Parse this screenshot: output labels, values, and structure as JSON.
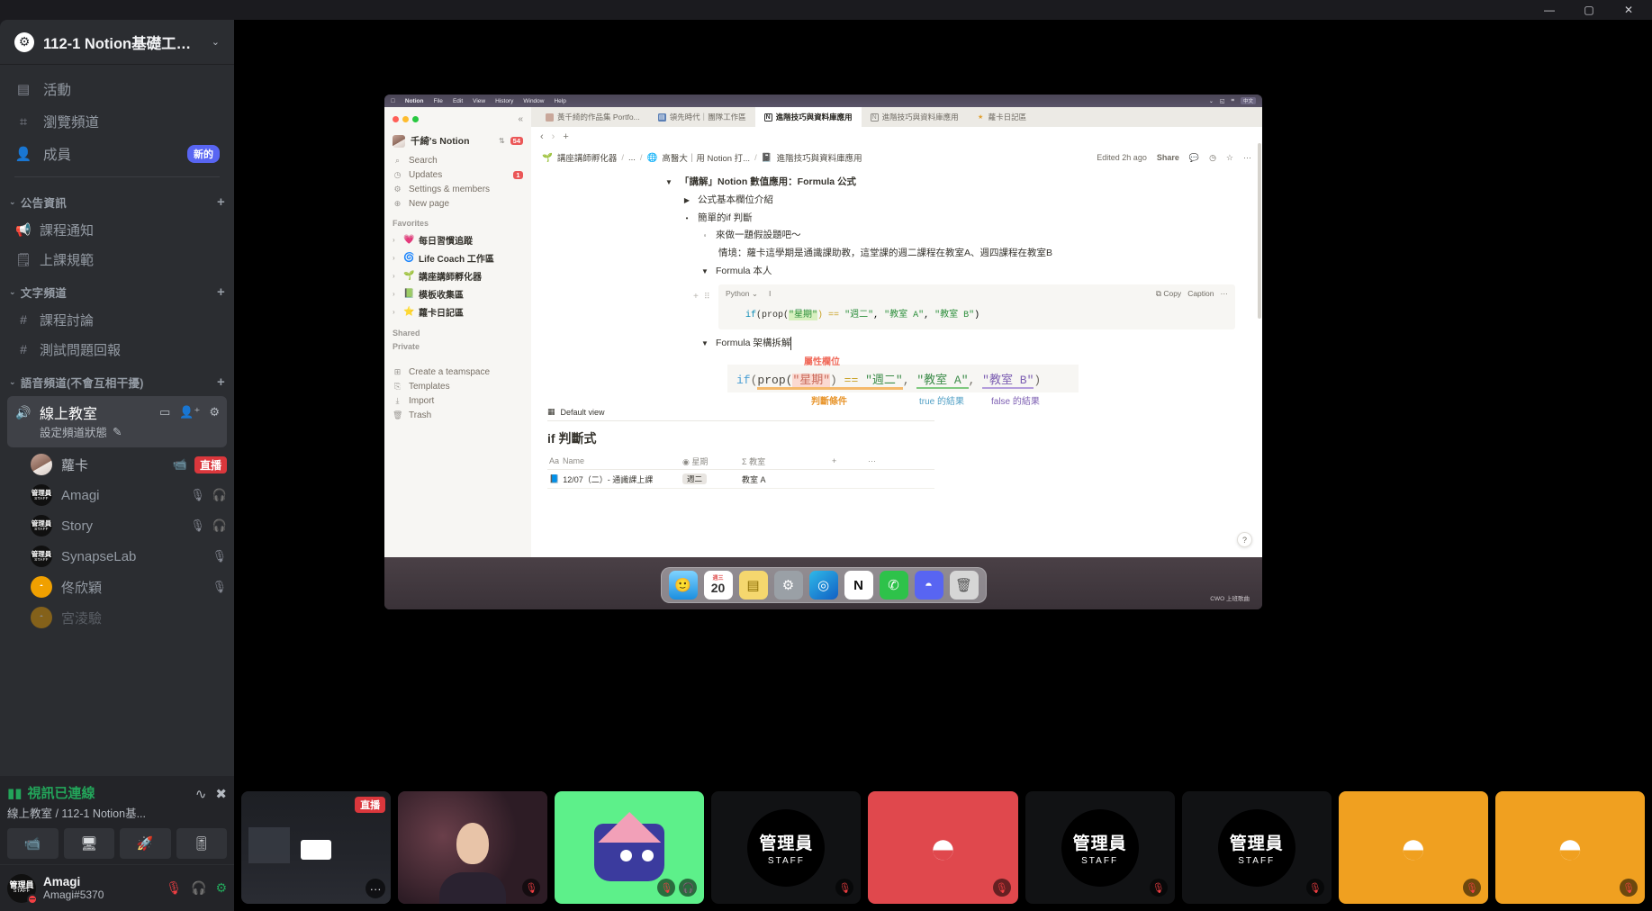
{
  "window": {
    "minimize": "—",
    "maximize": "▢",
    "close": "✕"
  },
  "sidebar": {
    "guild": {
      "name": "112-1 Notion基礎工作...",
      "icon": "gear-icon",
      "caret": "⌄"
    },
    "nav": [
      {
        "icon": "calendar-icon",
        "glyph": "▤",
        "label": "活動",
        "badge": ""
      },
      {
        "icon": "compass-icon",
        "glyph": "⌗",
        "label": "瀏覽頻道",
        "badge": ""
      },
      {
        "icon": "members-icon",
        "glyph": "👤",
        "label": "成員",
        "badge": "新的"
      }
    ],
    "categories": [
      {
        "name": "公告資訊",
        "caret": "⌄",
        "plus": "+",
        "channels": [
          {
            "icon": "megaphone-icon",
            "glyph": "📢",
            "label": "課程通知"
          },
          {
            "icon": "rules-icon",
            "glyph": "🗒",
            "label": "上課規範"
          }
        ]
      },
      {
        "name": "文字頻道",
        "caret": "⌄",
        "plus": "+",
        "channels": [
          {
            "icon": "hash-lock-icon",
            "glyph": "#",
            "label": "課程討論"
          },
          {
            "icon": "hash-lock-icon",
            "glyph": "#",
            "label": "測試問題回報"
          }
        ]
      },
      {
        "name": "語音頻道(不會互相干擾)",
        "caret": "⌄",
        "plus": "+",
        "channels": []
      }
    ],
    "voice_channel": {
      "name": "線上教室",
      "icon": "speaker-lock-icon",
      "status_text": "設定頻道狀態",
      "status_icon": "pencil-icon",
      "actions": [
        "chat-icon",
        "invite-icon",
        "settings-icon"
      ]
    },
    "members": [
      {
        "name": "蘿卡",
        "avatar": "photo",
        "live": true,
        "live_label": "直播",
        "icons": [
          "camera-icon"
        ]
      },
      {
        "name": "Amagi",
        "avatar": "staff",
        "icons": [
          "mic-muted-icon",
          "deafen-icon"
        ]
      },
      {
        "name": "Story",
        "avatar": "staff",
        "icons": [
          "mic-muted-icon",
          "deafen-icon"
        ]
      },
      {
        "name": "SynapseLab",
        "avatar": "staff",
        "icons": [
          "mic-muted-icon"
        ]
      },
      {
        "name": "佟欣穎",
        "avatar": "discord",
        "icons": [
          "mic-muted-icon"
        ]
      },
      {
        "name": "宮淩驗",
        "avatar": "discord",
        "icons": []
      }
    ],
    "voice_panel": {
      "title": "視訊已連線",
      "signal_icon": "signal-icon",
      "subtitle": "線上教室 / 112-1 Notion基...",
      "ping_icon": "ping-icon",
      "disconnect_icon": "disconnect-icon",
      "buttons": [
        "camera-icon",
        "screenshare-icon",
        "activity-rocket-icon",
        "soundboard-icon"
      ]
    },
    "user_panel": {
      "name": "Amagi",
      "tag": "Amagi#5370",
      "avatar_label": "管理員",
      "avatar_sub": "STAFF",
      "icons": [
        "mic-muted-icon",
        "deafen-muted-icon",
        "settings-icon"
      ]
    }
  },
  "screenshare": {
    "macos_menu": [
      "",
      "Notion",
      "File",
      "Edit",
      "View",
      "History",
      "Window",
      "Help"
    ],
    "macos_menu_right": [
      "⌄",
      "◱",
      "⌗",
      "中文"
    ],
    "notion": {
      "workspace": {
        "name": "千綺's Notion",
        "switch_icon": "chevron-updown-icon",
        "badge": "54"
      },
      "sidebar_items": [
        {
          "icon": "search-icon",
          "glyph": "⌕",
          "label": "Search",
          "badge": ""
        },
        {
          "icon": "clock-icon",
          "glyph": "◷",
          "label": "Updates",
          "badge": "1"
        },
        {
          "icon": "gear-icon",
          "glyph": "⚙",
          "label": "Settings & members",
          "badge": ""
        },
        {
          "icon": "plus-circle-icon",
          "glyph": "⊕",
          "label": "New page",
          "badge": ""
        }
      ],
      "sections": [
        {
          "title": "Favorites",
          "items": [
            {
              "emoji": "💗",
              "label": "每日習慣追蹤"
            },
            {
              "emoji": "🌀",
              "label": "Life Coach 工作區"
            },
            {
              "emoji": "🌱",
              "label": "講座講師孵化器"
            },
            {
              "emoji": "📗",
              "label": "模板收集區"
            },
            {
              "emoji": "⭐",
              "label": "蘿卡日記區"
            }
          ]
        },
        {
          "title": "Shared",
          "items": []
        },
        {
          "title": "Private",
          "items": []
        }
      ],
      "footer_items": [
        {
          "icon": "teamspace-icon",
          "glyph": "⊞",
          "label": "Create a teamspace"
        },
        {
          "icon": "templates-icon",
          "glyph": "⎘",
          "label": "Templates"
        },
        {
          "icon": "import-icon",
          "glyph": "⤓",
          "label": "Import"
        },
        {
          "icon": "trash-icon",
          "glyph": "🗑",
          "label": "Trash"
        }
      ],
      "tabs": [
        {
          "label": "黃千綺的作品集 Portfo...",
          "icon": "avatar-icon",
          "color": "#c9a79a",
          "active": false
        },
        {
          "label": "領先時代｜團隊工作區",
          "icon": "page-icon",
          "color": "#5b7fb5",
          "active": false
        },
        {
          "label": "進階技巧與資料庫應用",
          "icon": "notion-icon",
          "color": "#2f2f2f",
          "active": true
        },
        {
          "label": "進階技巧與資料庫應用",
          "icon": "notion-icon",
          "color": "#8d8b86",
          "active": false
        },
        {
          "label": "蘿卡日記區",
          "icon": "star-icon",
          "color": "#e0a030",
          "active": false
        }
      ],
      "nav_icons": [
        "collapse-icon",
        "back-icon",
        "forward-icon",
        "new-tab-icon"
      ],
      "breadcrumb": [
        {
          "emoji": "🌱",
          "label": "講座講師孵化器"
        },
        {
          "emoji": "",
          "label": "..."
        },
        {
          "emoji": "🌐",
          "label": "高醫大｜用 Notion 打..."
        },
        {
          "emoji": "📓",
          "label": "進階技巧與資料庫應用"
        }
      ],
      "page_actions": {
        "edited": "Edited 2h ago",
        "share": "Share",
        "comment_icon": "comment-icon",
        "clock_icon": "clock-icon",
        "star_icon": "star-icon",
        "more_icon": "more-icon"
      },
      "doc": {
        "lines": [
          {
            "marker": "▼",
            "text": "「講解」Notion 數值應用：Formula 公式",
            "indent": 0,
            "bold": true
          },
          {
            "marker": "▶",
            "text": "公式基本欄位介紹",
            "indent": 1,
            "bold": false
          },
          {
            "marker": "•",
            "text": "簡單的if 判斷",
            "indent": 1,
            "bold": false
          },
          {
            "marker": "◦",
            "text": "來做一題假設題吧～",
            "indent": 2,
            "bold": false
          },
          {
            "marker": "",
            "text": "情境：蘿卡這學期是通識課助教，這堂課的週二課程在教室A、週四課程在教室B",
            "indent": 3,
            "bold": false
          },
          {
            "marker": "▼",
            "text": "Formula 本人",
            "indent": 2,
            "bold": false
          }
        ],
        "code_block": {
          "language": "Python",
          "lang_caret": "⌄",
          "cursor_icon": "text-cursor-icon",
          "copy": "Copy",
          "caption": "Caption",
          "more": "···",
          "plus": "+",
          "drag": "⠿",
          "code_if": "if",
          "code_prop": "(prop(",
          "code_prop_arg": "\"星期\"",
          "code_eq": ") == ",
          "code_val1": "\"週二\"",
          "code_c1": ", ",
          "code_val2": "\"教室 A\"",
          "code_c2": ", ",
          "code_val3": "\"教室 B\"",
          "code_end": ")"
        },
        "section2": {
          "marker": "▼",
          "text": "Formula 架構拆解"
        },
        "diagram": {
          "annotation_top": "屬性欄位",
          "annotation_bottom_left": "判斷條件",
          "annotation_true": "true 的結果",
          "annotation_false": "false 的結果",
          "expr_if": "if",
          "expr_open": "(",
          "expr_prop": "prop(",
          "expr_arg": "\"星期\"",
          "expr_close": ")",
          "expr_eq": "==",
          "expr_v1": "\"週二\"",
          "expr_comma1": ",",
          "expr_v2": "\"教室 A\"",
          "expr_comma2": ",",
          "expr_v3": "\"教室 B\"",
          "expr_paren": ")"
        },
        "database": {
          "view_tab": "Default view",
          "view_icon": "table-icon",
          "title": "if 判斷式",
          "columns": [
            {
              "icon": "Aa",
              "label": "Name"
            },
            {
              "icon": "◉",
              "label": "星期"
            },
            {
              "icon": "Σ",
              "label": "教室"
            },
            {
              "icon": "+",
              "label": ""
            },
            {
              "icon": "···",
              "label": ""
            }
          ],
          "rows": [
            {
              "icon": "📘",
              "name": "12/07（二）- 通識課上課",
              "day": "週二",
              "room": "教室 A"
            }
          ]
        },
        "help_button": "?"
      }
    },
    "dock": [
      {
        "name": "finder-icon",
        "glyph": "🙂",
        "color": "#2aa3e8"
      },
      {
        "name": "calendar-icon",
        "glyph": "20",
        "color": "#ffffff",
        "sub": "週三"
      },
      {
        "name": "notes-icon",
        "glyph": "▤",
        "color": "#f5d76e"
      },
      {
        "name": "settings-icon",
        "glyph": "⚙",
        "color": "#9aa0a6"
      },
      {
        "name": "edge-icon",
        "glyph": "◎",
        "color": "#1f9bd8"
      },
      {
        "name": "notion-icon",
        "glyph": "N",
        "color": "#ffffff"
      },
      {
        "name": "line-icon",
        "glyph": "✆",
        "color": "#2ec24a"
      },
      {
        "name": "discord-icon",
        "glyph": "◓",
        "color": "#5865f2"
      },
      {
        "name": "trash-icon",
        "glyph": "🗑",
        "color": "#d6d6d6"
      }
    ],
    "watermark": "CWO 上班歌曲"
  },
  "participants": [
    {
      "type": "screen",
      "label": "",
      "live_badge": "直播",
      "more": "···"
    },
    {
      "type": "camera",
      "label": "",
      "muted": true,
      "muted_icon": "mic-muted-icon"
    },
    {
      "type": "avatar-green",
      "label": "",
      "muted": true,
      "icons": [
        "mic-muted-icon",
        "deafen-icon"
      ]
    },
    {
      "type": "staff",
      "label": "管理員",
      "sub": "STAFF",
      "bg": "#111214",
      "muted": true
    },
    {
      "type": "discord",
      "label": "",
      "bg": "#e0484d",
      "muted": true
    },
    {
      "type": "staff",
      "label": "管理員",
      "sub": "STAFF",
      "bg": "#111214",
      "muted": true
    },
    {
      "type": "staff",
      "label": "管理員",
      "sub": "STAFF",
      "bg": "#111214",
      "muted": true
    },
    {
      "type": "discord",
      "label": "",
      "bg": "#f0a020",
      "muted": true
    },
    {
      "type": "discord",
      "label": "",
      "bg": "#f0a020",
      "muted": true
    }
  ]
}
